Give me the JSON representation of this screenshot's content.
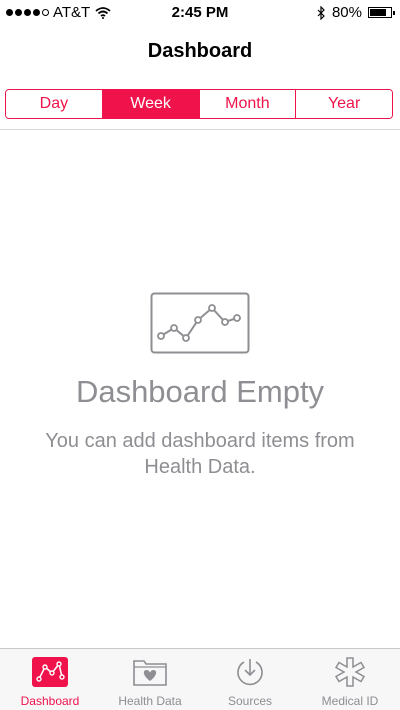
{
  "status_bar": {
    "carrier": "AT&T",
    "time": "2:45 PM",
    "battery_percent": "80%",
    "battery_level": 0.8,
    "icons": [
      "signal-dots-icon",
      "wifi-icon",
      "bluetooth-icon",
      "battery-icon"
    ]
  },
  "nav": {
    "title": "Dashboard",
    "segments": [
      {
        "label": "Day"
      },
      {
        "label": "Week",
        "selected": true
      },
      {
        "label": "Month"
      },
      {
        "label": "Year"
      }
    ]
  },
  "empty_state": {
    "icon": "line-chart-icon",
    "title": "Dashboard Empty",
    "description": "You can add dashboard items from Health Data."
  },
  "tab_bar": {
    "items": [
      {
        "label": "Dashboard",
        "icon": "dashboard-icon",
        "active": true
      },
      {
        "label": "Health Data",
        "icon": "health-data-folder-icon"
      },
      {
        "label": "Sources",
        "icon": "sources-icon"
      },
      {
        "label": "Medical ID",
        "icon": "medical-id-icon"
      }
    ]
  },
  "colors": {
    "accent": "#f0134b",
    "muted_text": "#8e8e93",
    "tab_bar_bg": "#f7f7f7"
  }
}
